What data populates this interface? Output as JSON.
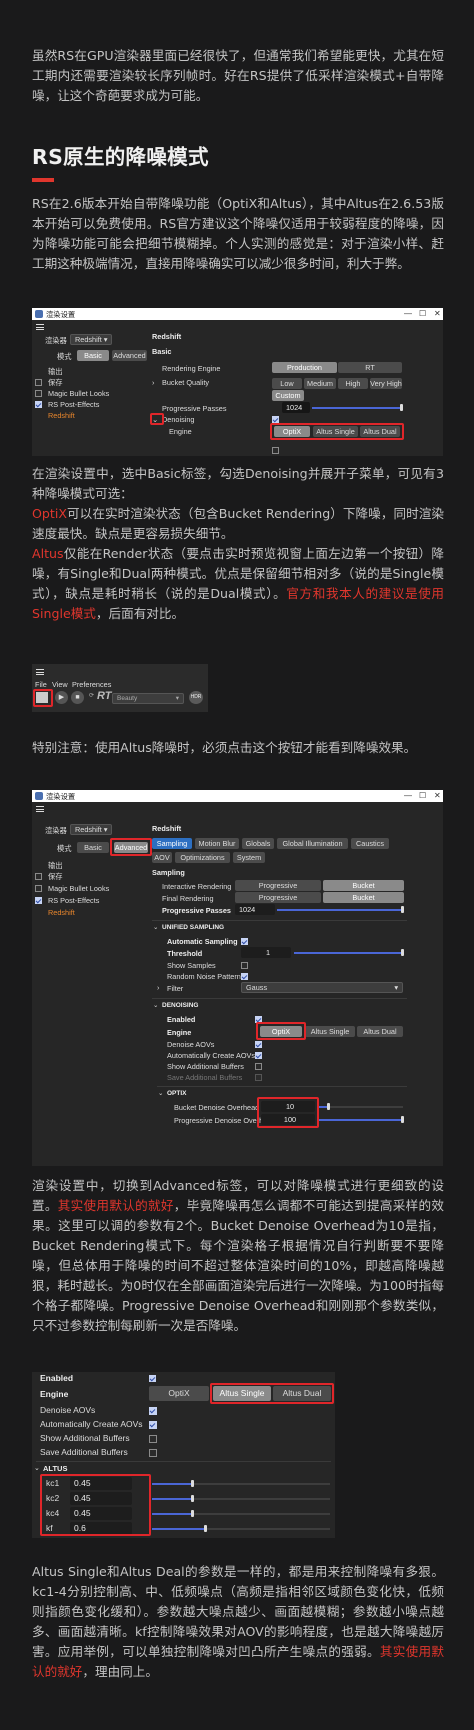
{
  "intro": "虽然RS在GPU渲染器里面已经很快了，但通常我们希望能更快，尤其在短工期内还需要渲染较长序列帧时。好在RS提供了低采样渲染模式+自带降噪，让这个奇葩要求成为可能。",
  "section_title": "RS原生的降噪模式",
  "para1": "RS在2.6版本开始自带降噪功能（OptiX和Altus），其中Altus在2.6.53版本开始可以免费使用。RS官方建议这个降噪仅适用于较弱程度的降噪，因为降噪功能可能会把细节模糊掉。个人实测的感觉是：对于渲染小样、赶工期这种极端情况，直接用降噪确实可以减少很多时间，利大于弊。",
  "para2": "在渲染设置中，选中Basic标签，勾选Denoising并展开子菜单，可见有3种降噪模式可选：",
  "para3_red": "OptiX",
  "para3": "可以在实时渲染状态（包含Bucket Rendering）下降噪，同时渲染速度最快。缺点是更容易损失细节。",
  "para4_red": "Altus",
  "para4": "仅能在Render状态（要点击实时预览视窗上面左边第一个按钮）降噪，有Single和Dual两种模式。优点是保留细节相对多（说的是Single模式），缺点是耗时稍长（说的是Dual模式）。",
  "para4_red2": "官方和我本人的建议是使用Single模式",
  "para4_tail": "，后面有对比。",
  "para5": "特别注意：使用Altus降噪时，必须点击这个按钮才能看到降噪效果。",
  "para6": "渲染设置中，切换到Advanced标签，可以对降噪模式进行更细致的设置。",
  "para6_red": "其实使用默认的就好",
  "para6b": "，毕竟降噪再怎么调都不可能达到提高采样的效果。这里可以调的参数有2个。Bucket Denoise Overhead为10是指，Bucket Rendering模式下。每个渲染格子根据情况自行判断要不要降噪，但总体用于降噪的时间不超过整体渲染时间的10%，即越高降噪越狠，耗时越长。为0时仅在全部画面渲染完后进行一次降噪。为100时指每个格子都降噪。Progressive Denoise Overhead和刚刚那个参数类似，只不过参数控制每刷新一次是否降噪。",
  "para7": "Altus Single和Altus Deal的参数是一样的，都是用来控制降噪有多狠。kc1-4分别控制高、中、低频噪点（高频是指相邻区域颜色变化快，低频则指颜色变化缓和）。参数越大噪点越少、画面越模糊；参数越小噪点越多、画面越清晰。kf控制降噪效果对AOV的影响程度，也是越大降噪越厉害。应用举例，可以单独控制降噪对凹凸所产生噪点的强弱。",
  "para7_red": "其实使用默认的就好",
  "para7_tail": "，理由同上。",
  "s1": {
    "title": "渲染设置",
    "renderer_label": "渲染器",
    "renderer": "Redshift",
    "mode_label": "模式",
    "tab_basic": "Basic",
    "tab_advanced": "Advanced",
    "list": [
      "输出",
      "保存",
      "Magic Bullet Looks",
      "RS Post-Effects",
      "Redshift"
    ],
    "heading": "Redshift",
    "sub": "Basic",
    "rendering_engine": "Rendering Engine",
    "production": "Production",
    "rt": "RT",
    "bucket_quality": "Bucket Quality",
    "q_low": "Low",
    "q_medium": "Medium",
    "q_high": "High",
    "q_veryhigh": "Very High",
    "q_custom": "Custom",
    "progressive_passes": "Progressive Passes",
    "progressive_value": "1024",
    "denoising": "Denoising",
    "engine": "Engine",
    "optix": "OptiX",
    "altus_single": "Altus Single",
    "altus_dual": "Altus Dual"
  },
  "s2": {
    "menu": [
      "File",
      "View",
      "Preferences"
    ],
    "rt": "RT",
    "beauty": "Beauty"
  },
  "s3": {
    "title": "渲染设置",
    "renderer_label": "渲染器",
    "renderer": "Redshift",
    "mode_label": "模式",
    "tab_basic": "Basic",
    "tab_advanced": "Advanced",
    "list": [
      "输出",
      "保存",
      "Magic Bullet Looks",
      "RS Post-Effects",
      "Redshift"
    ],
    "heading": "Redshift",
    "tabs": [
      "Sampling",
      "Motion Blur",
      "Globals",
      "Global Illumination",
      "Caustics",
      "AOV",
      "Optimizations",
      "System"
    ],
    "sampling": "Sampling",
    "interactive_rendering": "Interactive Rendering",
    "final_rendering": "Final Rendering",
    "progressive": "Progressive",
    "bucket": "Bucket",
    "progressive_passes": "Progressive Passes",
    "progressive_value": "1024",
    "unified_sampling": "UNIFIED SAMPLING",
    "automatic_sampling": "Automatic Sampling",
    "threshold": "Threshold",
    "threshold_value": "1",
    "show_samples": "Show Samples",
    "random_noise": "Random Noise Pattern",
    "filter": "Filter",
    "gauss": "Gauss",
    "denoising_section": "DENOISING",
    "enabled": "Enabled",
    "engine": "Engine",
    "optix": "OptiX",
    "altus_single": "Altus Single",
    "altus_dual": "Altus Dual",
    "denoise_aovs": "Denoise AOVs",
    "auto_create_aovs": "Automatically Create AOVs",
    "show_additional": "Show Additional Buffers",
    "save_additional": "Save Additional Buffers",
    "optix_section": "OPTIX",
    "bucket_overhead": "Bucket Denoise Overhead",
    "bucket_overhead_value": "10",
    "progressive_overhead": "Progressive Denoise Overhead",
    "progressive_overhead_value": "100"
  },
  "s4": {
    "enabled": "Enabled",
    "engine": "Engine",
    "optix": "OptiX",
    "altus_single": "Altus Single",
    "altus_dual": "Altus Dual",
    "denoise_aovs": "Denoise AOVs",
    "auto_create_aovs": "Automatically Create AOVs",
    "show_additional": "Show Additional Buffers",
    "save_additional": "Save Additional Buffers",
    "altus": "ALTUS",
    "params": [
      {
        "name": "kc1",
        "value": "0.45",
        "level": 0.45
      },
      {
        "name": "kc2",
        "value": "0.45",
        "level": 0.45
      },
      {
        "name": "kc4",
        "value": "0.45",
        "level": 0.45
      },
      {
        "name": "kf",
        "value": "0.6",
        "level": 0.6
      }
    ]
  }
}
